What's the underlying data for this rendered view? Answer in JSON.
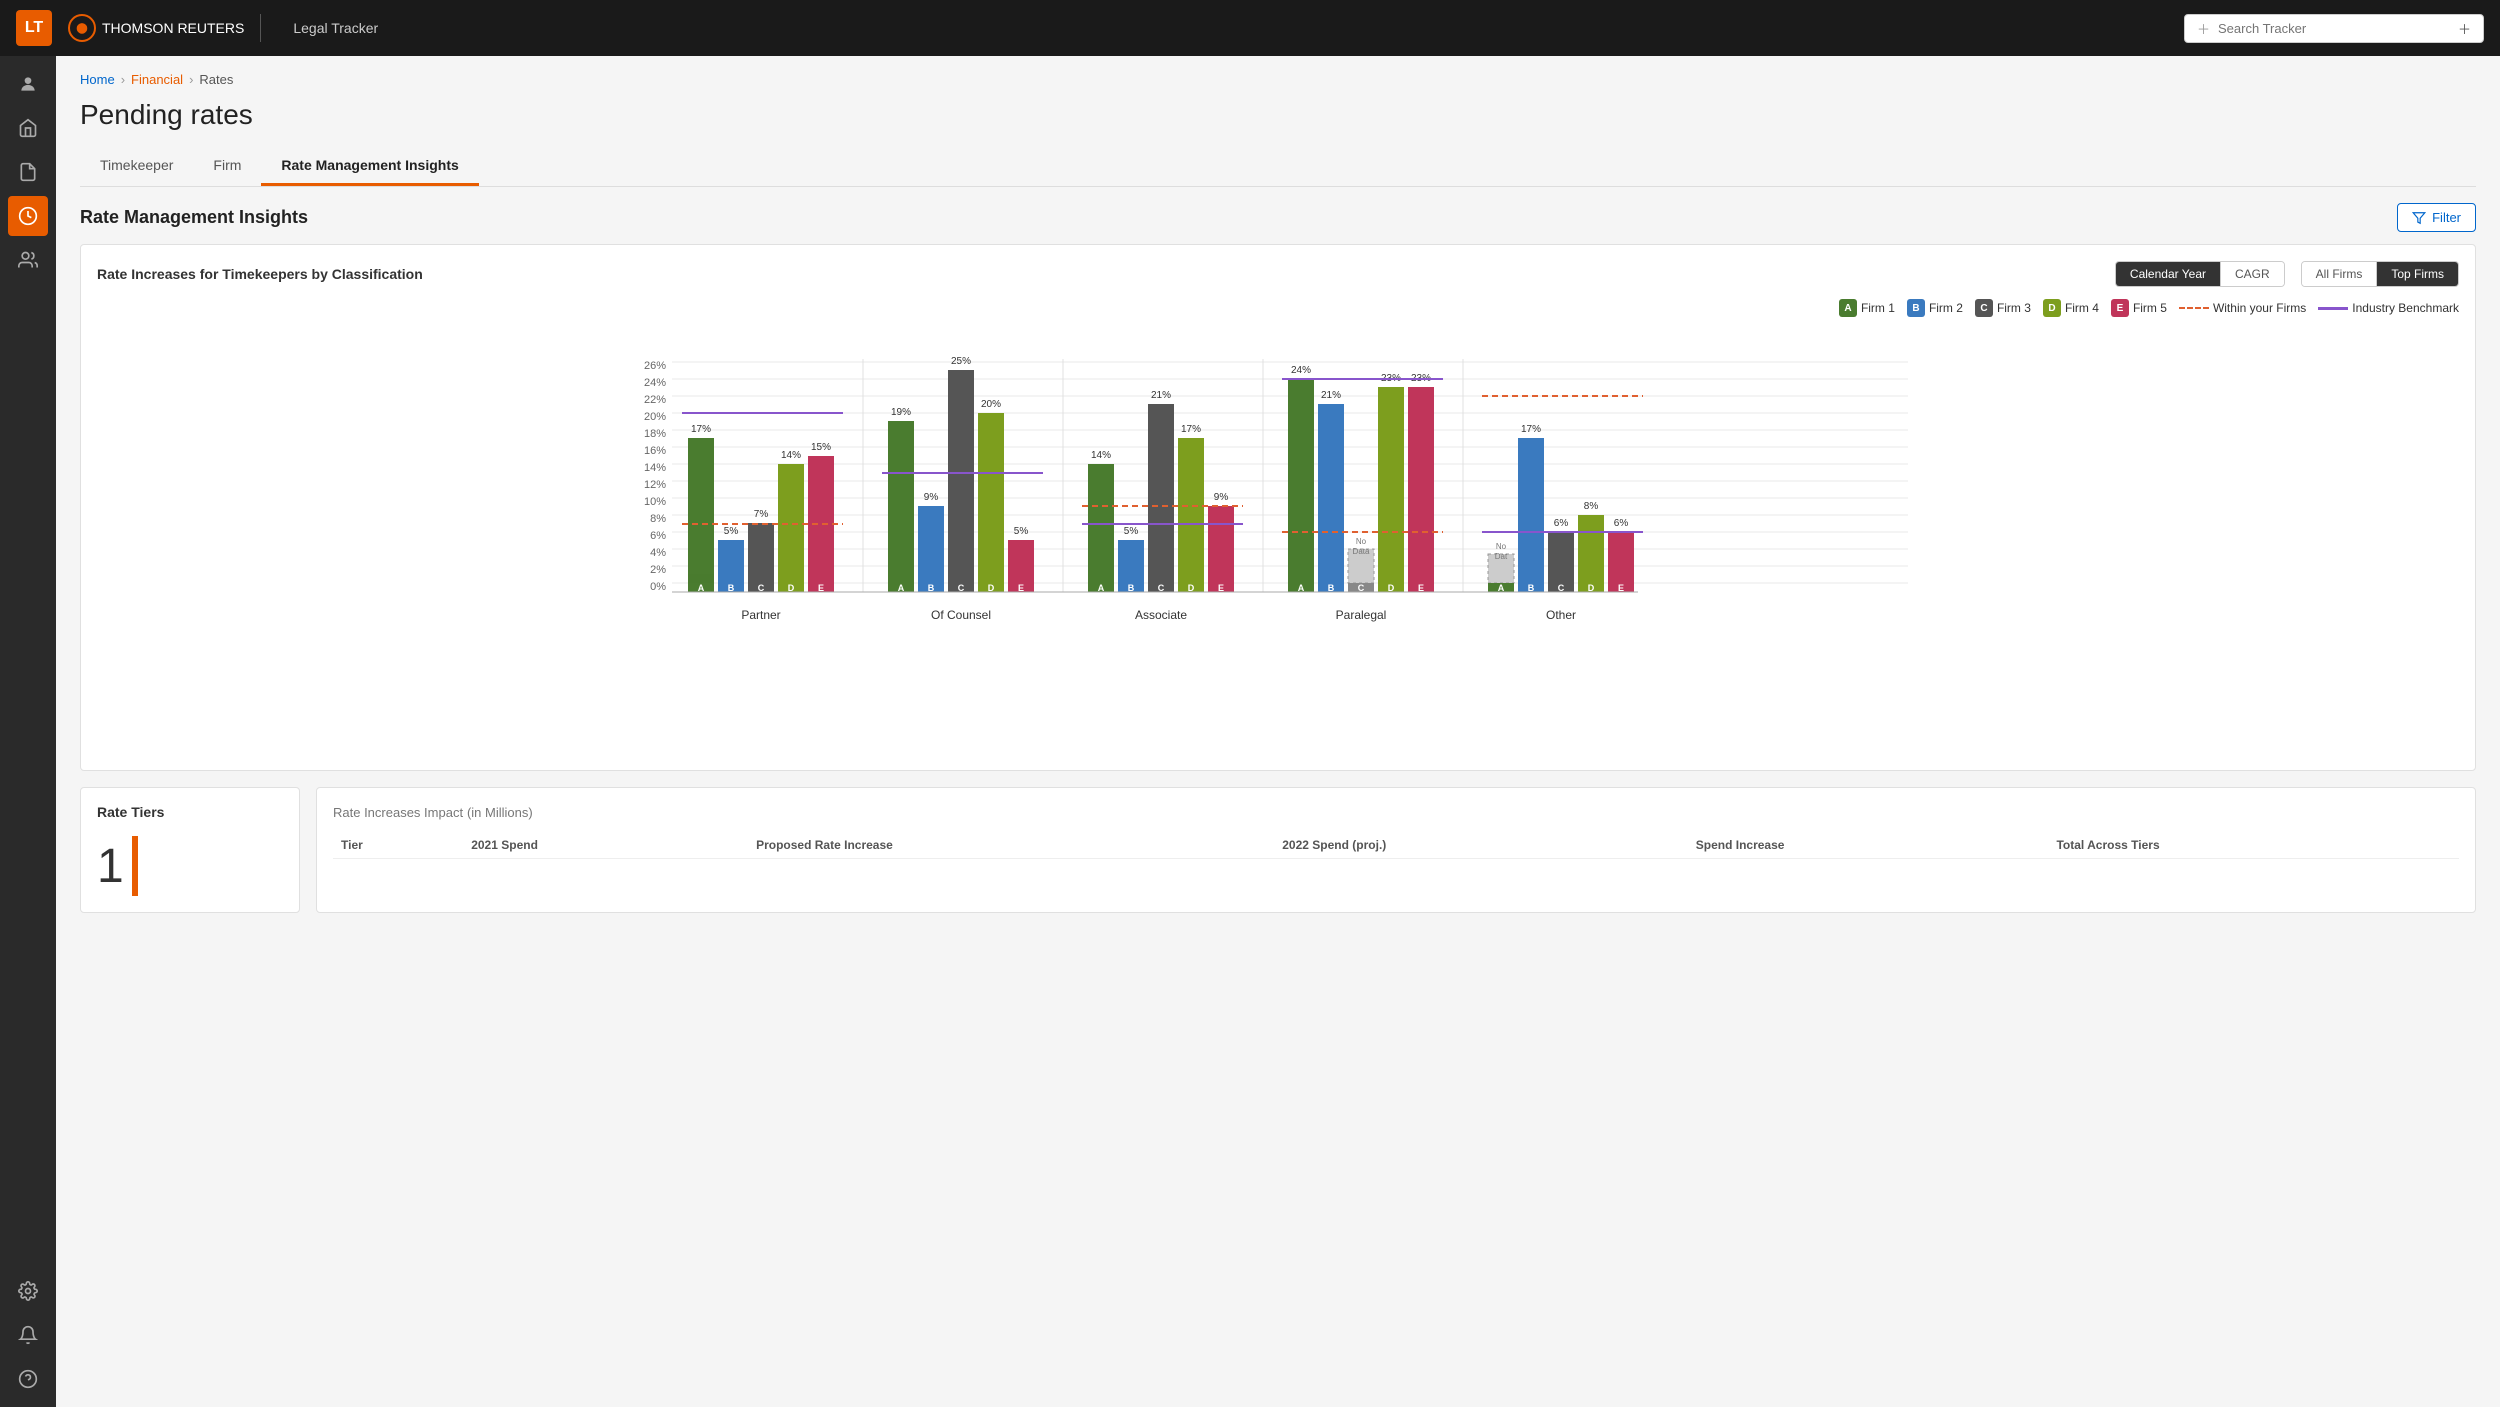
{
  "app": {
    "badge": "LT",
    "brand": "THOMSON REUTERS",
    "product": "Legal Tracker",
    "search_placeholder": "Search Tracker"
  },
  "nav": {
    "items": [
      {
        "icon": "👤",
        "name": "user",
        "active": false
      },
      {
        "icon": "🏠",
        "name": "home",
        "active": false
      },
      {
        "icon": "📄",
        "name": "document",
        "active": false
      },
      {
        "icon": "$",
        "name": "financial",
        "active": true
      },
      {
        "icon": "👥",
        "name": "people",
        "active": false
      },
      {
        "icon": "📋",
        "name": "reports",
        "active": false
      },
      {
        "icon": "📈",
        "name": "analytics",
        "active": false
      },
      {
        "icon": "⚙️",
        "name": "settings",
        "active": false
      },
      {
        "icon": "🔔",
        "name": "notifications",
        "active": false
      },
      {
        "icon": "?",
        "name": "help",
        "active": false
      }
    ]
  },
  "breadcrumb": {
    "items": [
      "Home",
      "Financial",
      "Rates"
    ]
  },
  "page": {
    "title": "Pending rates"
  },
  "tabs": [
    {
      "label": "Timekeeper",
      "active": false
    },
    {
      "label": "Firm",
      "active": false
    },
    {
      "label": "Rate Management Insights",
      "active": true
    }
  ],
  "section": {
    "title": "Rate Management Insights",
    "filter_btn": "Filter"
  },
  "chart": {
    "title": "Rate Increases for Timekeepers by Classification",
    "time_controls": [
      "Calendar Year",
      "CAGR"
    ],
    "firm_controls": [
      "All Firms",
      "Top Firms"
    ],
    "active_time": "Calendar Year",
    "active_firm": "Top Firms",
    "legend": [
      {
        "label": "Firm 1",
        "code": "A",
        "color": "#4a7c2f"
      },
      {
        "label": "Firm 2",
        "code": "B",
        "color": "#3a7abf"
      },
      {
        "label": "Firm 3",
        "code": "C",
        "color": "#555555"
      },
      {
        "label": "Firm 4",
        "code": "D",
        "color": "#7d9e1e"
      },
      {
        "label": "Firm 5",
        "code": "E",
        "color": "#c0355a"
      },
      {
        "label": "Within your Firms",
        "type": "dashed",
        "color": "#e06030"
      },
      {
        "label": "Industry Benchmark",
        "type": "line",
        "color": "#8855cc"
      }
    ],
    "categories": [
      "Partner",
      "Of Counsel",
      "Associate",
      "Paralegal",
      "Other"
    ],
    "data": {
      "Partner": {
        "A": 17,
        "B": 5,
        "C": 7,
        "D": 14,
        "E": 15,
        "within": 7,
        "benchmark": 20
      },
      "Of Counsel": {
        "A": 19,
        "B": 9,
        "C": 25,
        "D": 20,
        "E": 5,
        "within": 13,
        "benchmark": 13
      },
      "Associate": {
        "A": 14,
        "B": 5,
        "C": 21,
        "D": 17,
        "E": 9,
        "within": 9,
        "benchmark": 7
      },
      "Paralegal": {
        "A": 24,
        "B": 21,
        "C": null,
        "D": 23,
        "E": 23,
        "within": 6,
        "benchmark": 24
      },
      "Other": {
        "A": null,
        "B": 17,
        "C": 6,
        "D": 8,
        "E": 6,
        "within": 22,
        "benchmark": 6
      }
    }
  },
  "rate_tiers": {
    "title": "Rate Tiers",
    "count": "1"
  },
  "rate_impact": {
    "title": "Rate Increases Impact",
    "subtitle": "(in Millions)",
    "columns": [
      "Tier",
      "2021 Spend",
      "Proposed Rate Increase",
      "2022 Spend (proj.)",
      "Spend Increase",
      "Total Across Tiers"
    ],
    "rows": []
  }
}
